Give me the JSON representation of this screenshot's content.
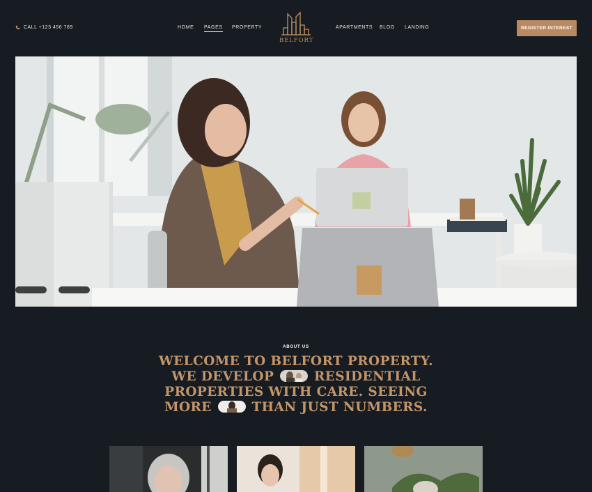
{
  "header": {
    "phone": "CALL +123 456 789",
    "nav_left": [
      {
        "label": "HOME",
        "active": false
      },
      {
        "label": "PAGES",
        "active": true
      },
      {
        "label": "PROPERTY",
        "active": false
      }
    ],
    "brand": "BELFORT",
    "nav_right": [
      {
        "label": "APARTMENTS",
        "active": false
      },
      {
        "label": "BLOG",
        "active": false
      },
      {
        "label": "LANDING",
        "active": false
      }
    ],
    "cta": "REGISTER INTEREST"
  },
  "about": {
    "eyebrow": "ABOUT US",
    "line1": "WELCOME TO BELFORT PROPERTY.",
    "line2_a": "WE DEVELOP",
    "line2_b": "RESIDENTIAL",
    "line3": "PROPERTIES WITH CARE. SEEING",
    "line4_a": "MORE",
    "line4_b": "THAN JUST NUMBERS."
  },
  "colors": {
    "background": "#171b22",
    "accent": "#b98a61",
    "headline": "#c3956a"
  },
  "icons": {
    "phone": "phone-icon",
    "logo": "building-logo-icon"
  }
}
